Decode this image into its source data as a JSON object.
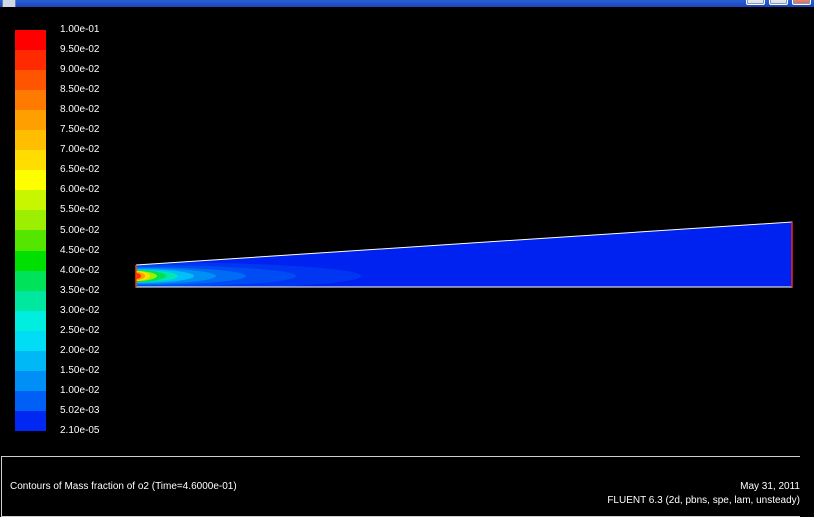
{
  "window": {
    "title": "",
    "controls": [
      "minimize-button",
      "maximize-button",
      "close-button"
    ]
  },
  "legend": {
    "labels": [
      "1.00e-01",
      "9.50e-02",
      "9.00e-02",
      "8.50e-02",
      "8.00e-02",
      "7.50e-02",
      "7.00e-02",
      "6.50e-02",
      "6.00e-02",
      "5.50e-02",
      "5.00e-02",
      "4.50e-02",
      "4.00e-02",
      "3.50e-02",
      "3.00e-02",
      "2.50e-02",
      "2.00e-02",
      "1.50e-02",
      "1.00e-02",
      "5.02e-03",
      "2.10e-05"
    ],
    "colors": [
      "#ff0000",
      "#ff2a00",
      "#ff5500",
      "#ff7a00",
      "#ff9f00",
      "#ffbf00",
      "#ffdd00",
      "#ffff00",
      "#c8f500",
      "#9cef00",
      "#55e600",
      "#00e000",
      "#00e25a",
      "#00e8a0",
      "#00eee0",
      "#00ddf5",
      "#00b8f5",
      "#0090f5",
      "#0060f5",
      "#0028f2"
    ]
  },
  "plot": {
    "field": "Mass fraction of o2",
    "value_range": [
      2.1e-05,
      0.1
    ]
  },
  "info": {
    "title": "Contours of Mass fraction of o2  (Time=4.6000e-01)",
    "date": "May 31, 2011",
    "solver": "FLUENT 6.3 (2d, pbns, spe, lam, unsteady)"
  }
}
